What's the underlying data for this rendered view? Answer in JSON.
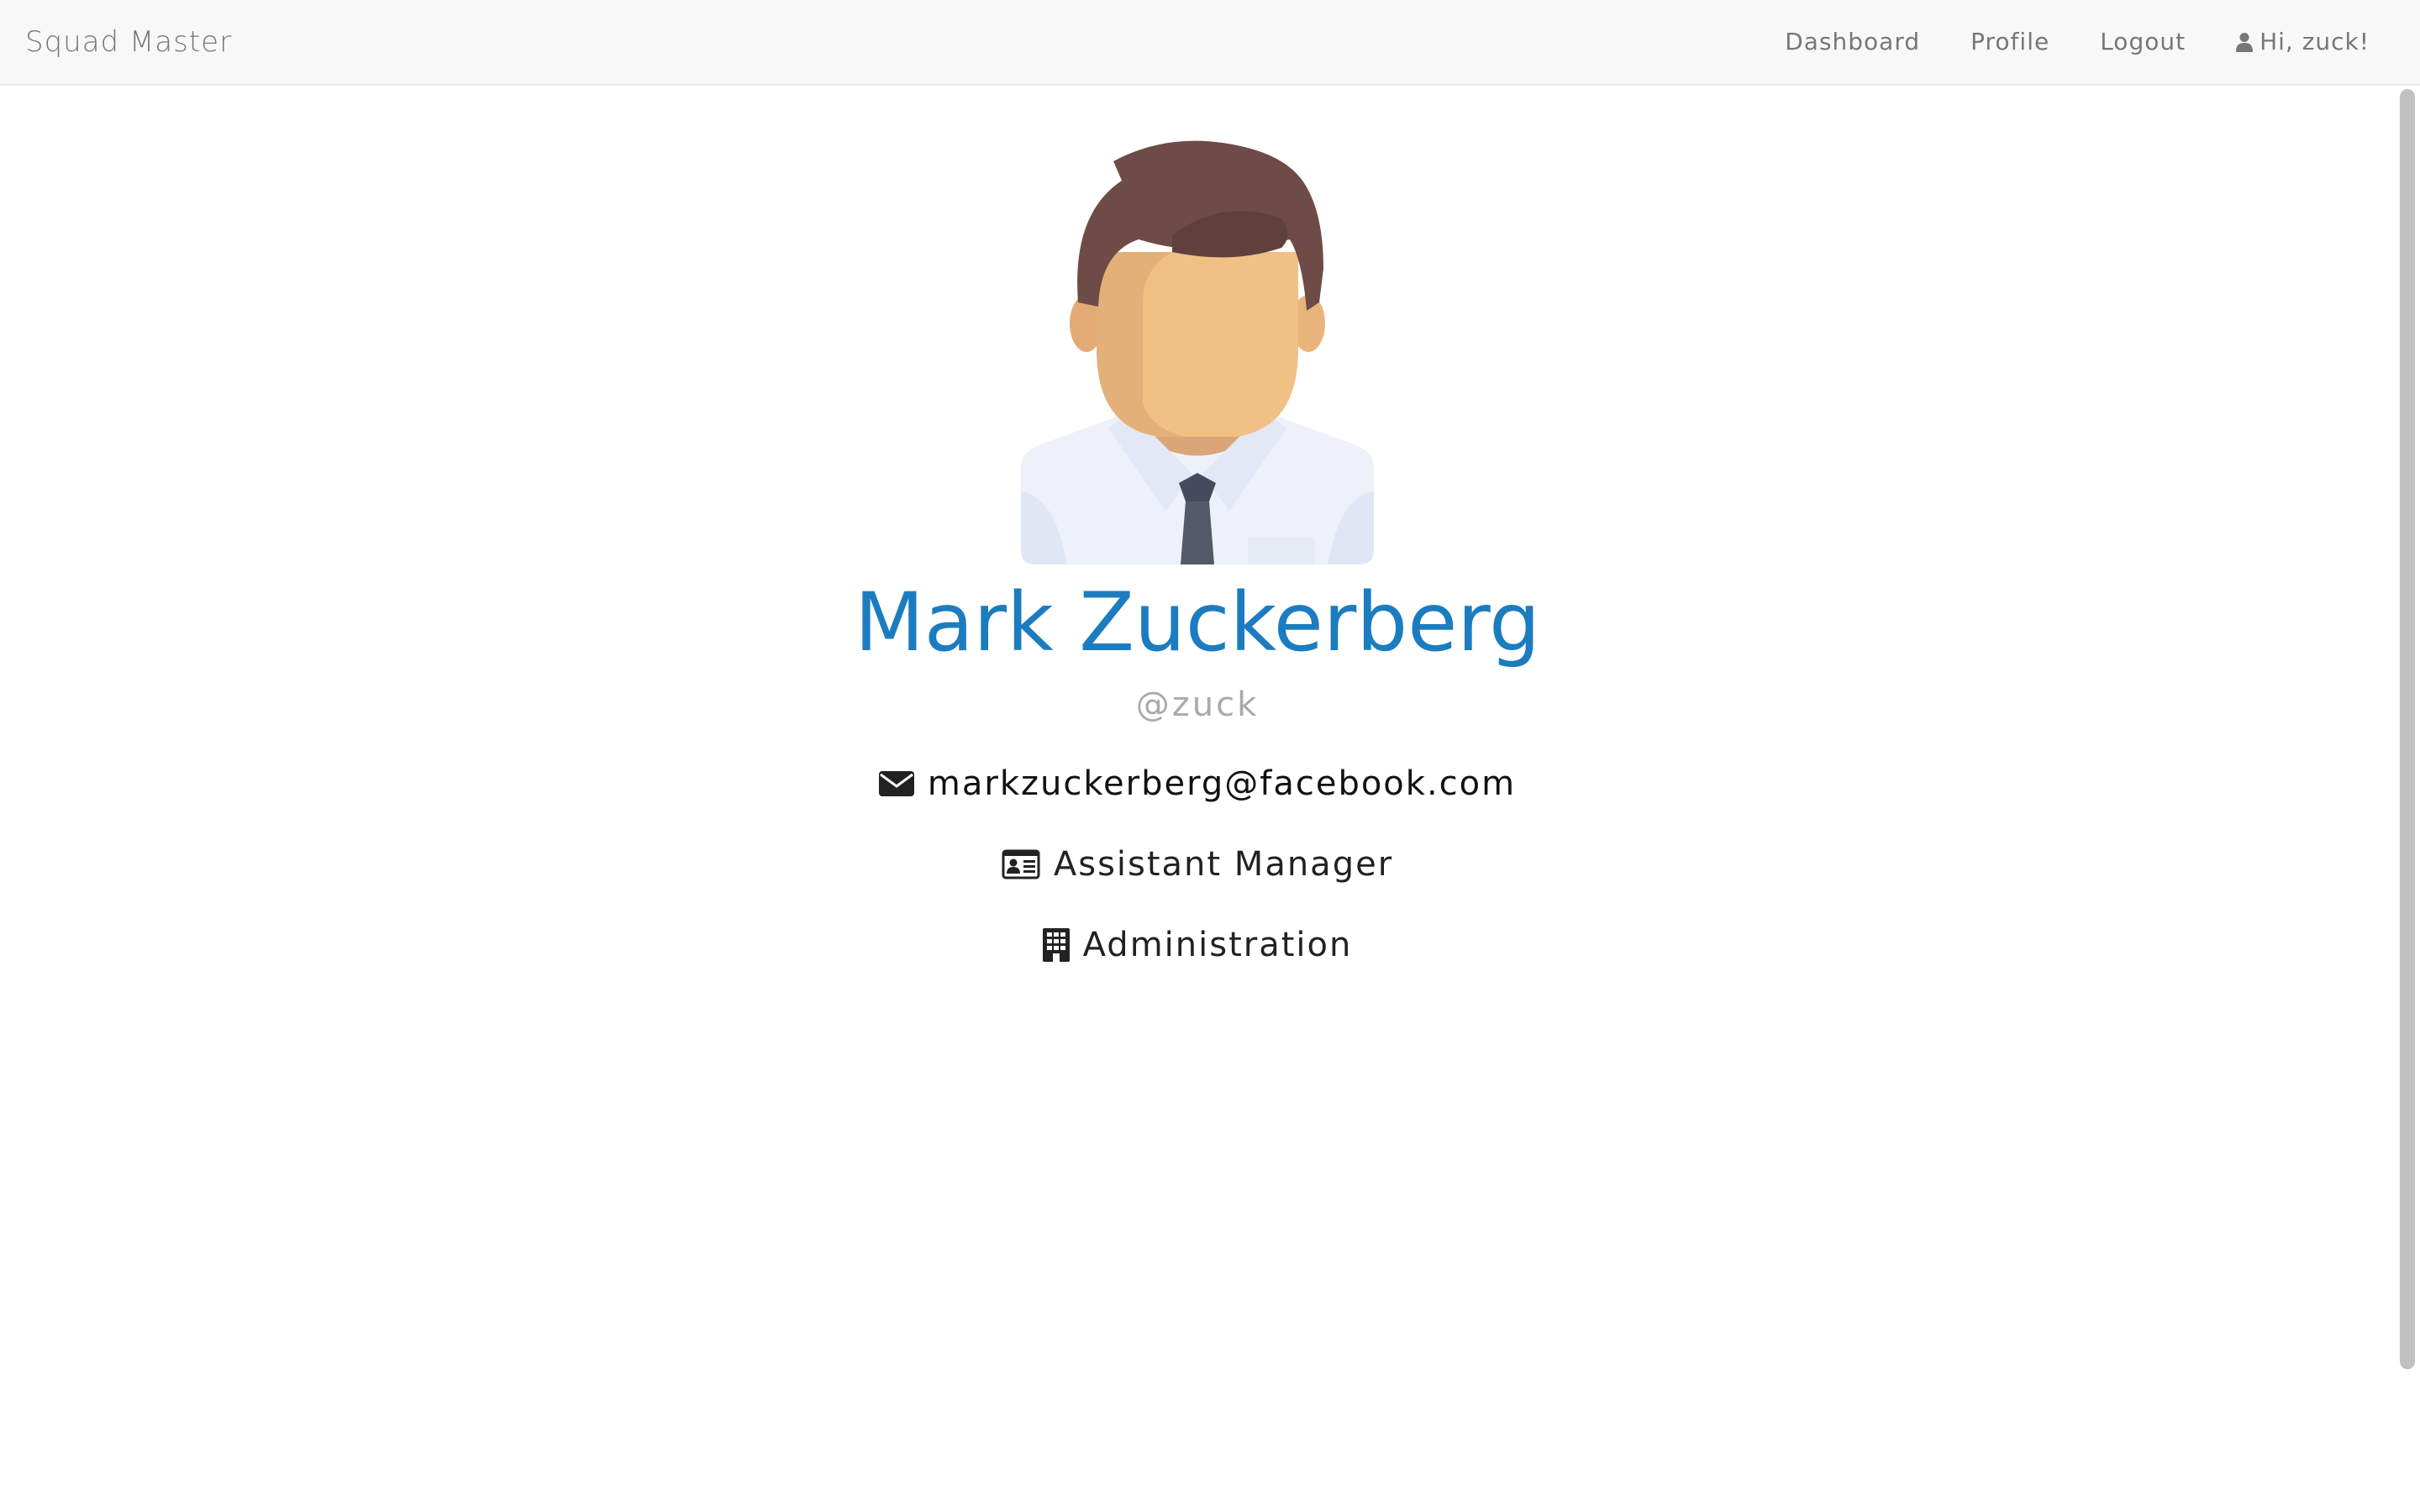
{
  "navbar": {
    "brand": "Squad Master",
    "links": [
      "Dashboard",
      "Profile",
      "Logout"
    ],
    "greeting": "Hi, zuck!",
    "greeting_icon": "user-icon"
  },
  "profile": {
    "avatar_icon": "avatar-man-with-tie",
    "full_name": "Mark Zuckerberg",
    "username": "@zuck",
    "email": "markzuckerberg@facebook.com",
    "email_icon": "envelope-icon",
    "job_title": "Assistant Manager",
    "job_title_icon": "id-card-icon",
    "department": "Administration",
    "department_icon": "building-icon"
  },
  "colors": {
    "name": "#1c7cc0",
    "navbar_bg": "#f8f8f8",
    "nav_text": "#777777",
    "username": "#aaaaaa"
  }
}
